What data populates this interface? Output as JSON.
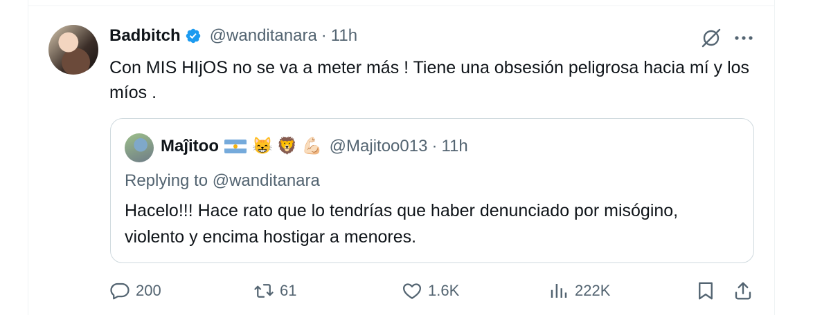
{
  "tweet": {
    "display_name": "Badbitch",
    "handle": "@wanditanara",
    "separator": "·",
    "time": "11h",
    "text": "Con MIS HIjOS no se va a meter más !  Tiene una obsesión peligrosa hacia mí y los míos ."
  },
  "quote": {
    "display_name": "Maĵitoo",
    "emojis": [
      "😸",
      "🦁",
      "💪🏻"
    ],
    "handle": "@Majitoo013",
    "separator": "·",
    "time": "11h",
    "replying_to": "Replying to @wanditanara",
    "text": "Hacelo!!! Hace rato que lo tendrías que haber denunciado por misógino, violento y encima hostigar a menores."
  },
  "actions": {
    "replies": "200",
    "retweets": "61",
    "likes": "1.6K",
    "views": "222K"
  },
  "icons": {
    "verified": "verified-badge-icon",
    "grok": "grok-icon",
    "more": "more-icon",
    "reply": "reply-icon",
    "retweet": "retweet-icon",
    "like": "like-icon",
    "views": "views-icon",
    "bookmark": "bookmark-icon",
    "share": "share-icon"
  },
  "colors": {
    "verified": "#1d9bf0",
    "muted": "#536471",
    "text": "#0f1419",
    "border": "#cfd9de"
  }
}
